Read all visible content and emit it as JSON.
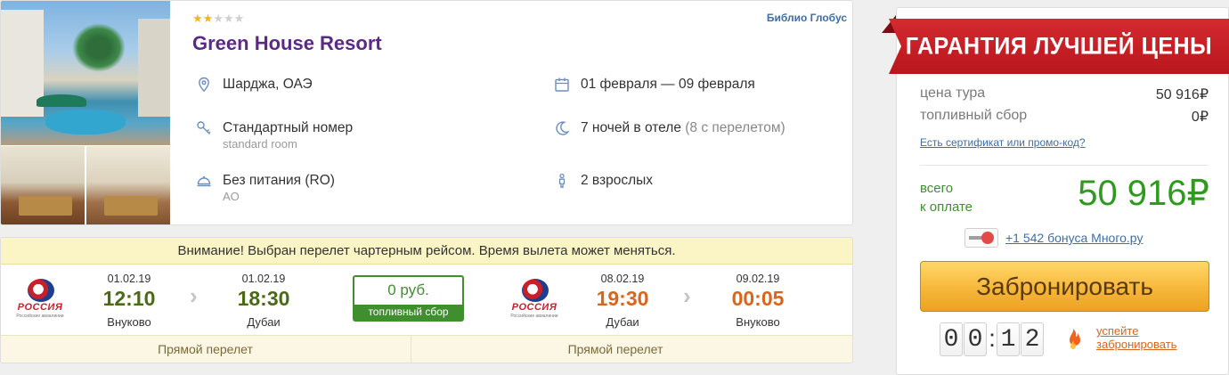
{
  "hotel": {
    "stars_total": 5,
    "stars_filled": 2,
    "name": "Green House Resort",
    "operator": "Библио Глобус",
    "location": "Шарджа, ОАЭ",
    "dates": "01 февраля — 09 февраля",
    "room": "Стандартный номер",
    "room_sub": "standard room",
    "nights": "7 ночей в отеле",
    "nights_extra": "(8 с перелетом)",
    "meal": "Без питания (RO)",
    "meal_sub": "AO",
    "guests": "2 взрослых"
  },
  "flight": {
    "notice": "Внимание! Выбран перелет чартерным рейсом. Время вылета может меняться.",
    "fuel_price": "0 руб.",
    "fuel_label": "топливный сбор",
    "airline_name": "РОССИЯ",
    "airline_tagline": "Российские авиалинии",
    "outbound": {
      "dep_date": "01.02.19",
      "dep_time": "12:10",
      "dep_city": "Внуково",
      "arr_date": "01.02.19",
      "arr_time": "18:30",
      "arr_city": "Дубаи",
      "type": "Прямой перелет"
    },
    "return": {
      "dep_date": "08.02.19",
      "dep_time": "19:30",
      "dep_city": "Дубаи",
      "arr_date": "09.02.19",
      "arr_time": "00:05",
      "arr_city": "Внуково",
      "type": "Прямой перелет"
    }
  },
  "price": {
    "guarantee": "ГАРАНТИЯ ЛУЧШЕЙ ЦЕНЫ",
    "tour_label": "цена тура",
    "tour_value": "50 916₽",
    "fuel_label": "топливный сбор",
    "fuel_value": "0₽",
    "promo_link": "Есть сертификат или промо-код?",
    "total_label_1": "всего",
    "total_label_2": "к оплате",
    "total_value": "50 916₽",
    "bonus": "+1 542 бонуса Много.ру",
    "book_button": "Забронировать",
    "timer": [
      "0",
      "0",
      "1",
      "2"
    ],
    "hurry_1": "успейте",
    "hurry_2": "забронировать"
  },
  "colors": {
    "hotel_name": "#5a2a86",
    "total_green": "#2f9a1d",
    "banner_red": "#c81f26",
    "button_orange": "#f6b73a",
    "time_green": "#4a6a18",
    "time_orange": "#d8661b"
  }
}
